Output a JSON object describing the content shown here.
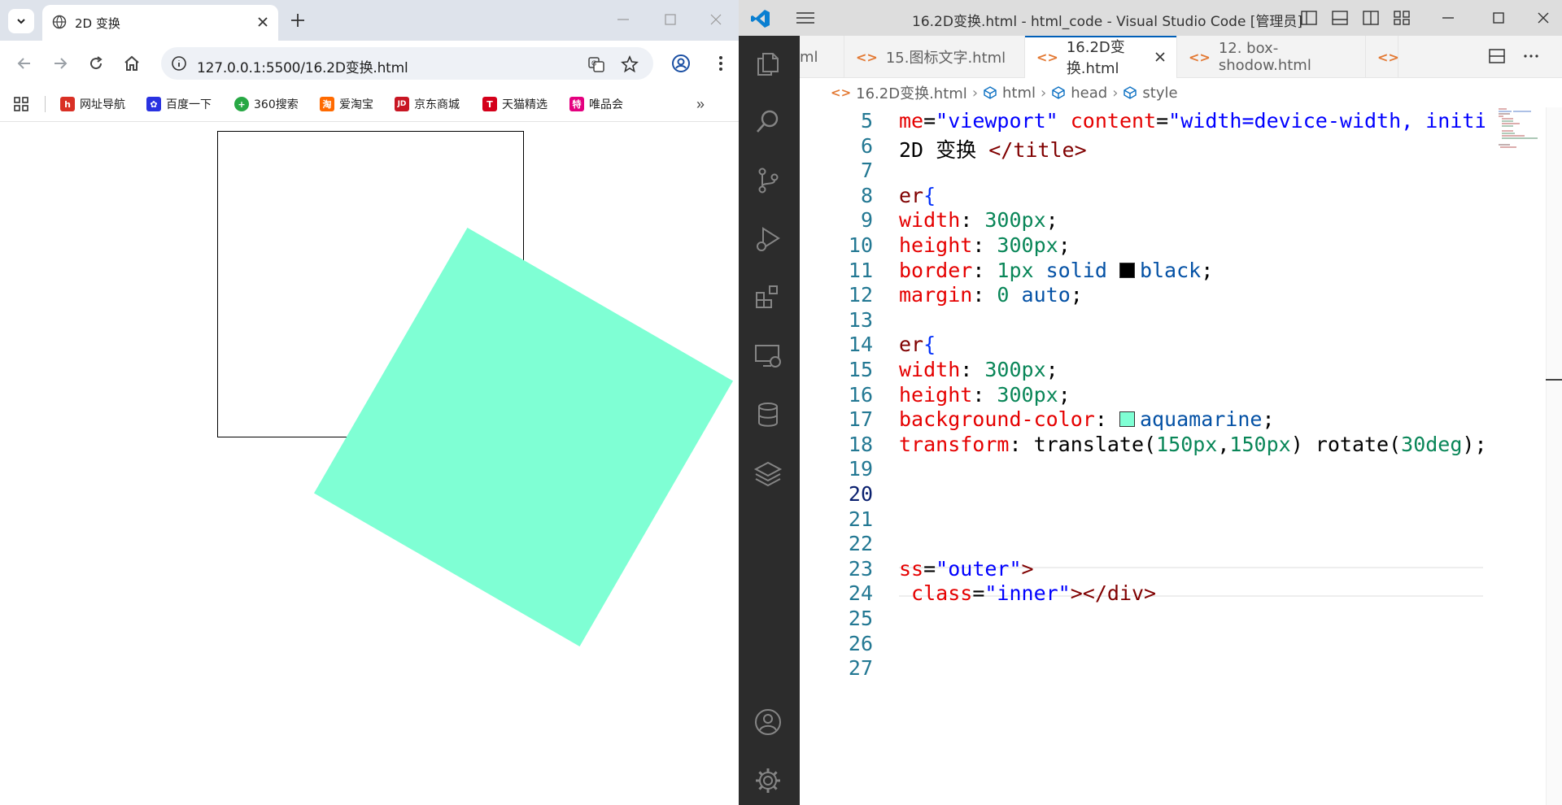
{
  "browser": {
    "tab_title": "2D 变换",
    "url": "127.0.0.1:5500/16.2D变换.html",
    "bookmarks": [
      {
        "label": "网址导航",
        "icon": "hao-icon",
        "color": "#d93025",
        "glyph": "h"
      },
      {
        "label": "百度一下",
        "icon": "baidu-icon",
        "color": "#2932e1",
        "glyph": "✿"
      },
      {
        "label": "360搜索",
        "icon": "360-icon",
        "color": "#27a844",
        "glyph": "+"
      },
      {
        "label": "爱淘宝",
        "icon": "taobao-icon",
        "color": "#ff6a00",
        "glyph": "淘"
      },
      {
        "label": "京东商城",
        "icon": "jd-icon",
        "color": "#c81623",
        "glyph": "JD"
      },
      {
        "label": "天猫精选",
        "icon": "tmall-icon",
        "color": "#d4001a",
        "glyph": "T"
      },
      {
        "label": "唯品会",
        "icon": "vip-icon",
        "color": "#e4007f",
        "glyph": "特"
      }
    ],
    "content": {
      "outer_border_color": "#000000",
      "inner_color": "#7fffd4",
      "inner_rotate_deg": 30
    }
  },
  "vscode": {
    "window_title": "16.2D变换.html - html_code - Visual Studio Code [管理员]",
    "tabs": [
      {
        "label": "ml",
        "active": false
      },
      {
        "label": "15.图标文字.html",
        "active": false
      },
      {
        "label": "16.2D变换.html",
        "active": true
      },
      {
        "label": "12. box-shodow.html",
        "active": false
      }
    ],
    "breadcrumbs": [
      "16.2D变换.html",
      "html",
      "head",
      "style"
    ],
    "current_line": 20,
    "lines": [
      {
        "n": 5
      },
      {
        "n": 6
      },
      {
        "n": 7
      },
      {
        "n": 8
      },
      {
        "n": 9
      },
      {
        "n": 10
      },
      {
        "n": 11
      },
      {
        "n": 12
      },
      {
        "n": 13
      },
      {
        "n": 14
      },
      {
        "n": 15
      },
      {
        "n": 16
      },
      {
        "n": 17
      },
      {
        "n": 18
      },
      {
        "n": 19
      },
      {
        "n": 20
      },
      {
        "n": 21
      },
      {
        "n": 22
      },
      {
        "n": 23
      },
      {
        "n": 24
      },
      {
        "n": 25
      },
      {
        "n": 26
      },
      {
        "n": 27
      }
    ],
    "code": {
      "l5_a": "me",
      "l5_b": "=",
      "l5_c": "\"viewport\"",
      "l5_d": " content",
      "l5_e": "=",
      "l5_f": "\"width=device-width, initi",
      "l6_a": "2D 变换 ",
      "l6_b": "</title>",
      "l8_a": "er",
      "l8_b": "{",
      "l9_a": "width",
      "l9_b": ": ",
      "l9_c": "300px",
      "l9_d": ";",
      "l10_a": "height",
      "l10_b": ": ",
      "l10_c": "300px",
      "l10_d": ";",
      "l11_a": "border",
      "l11_b": ": ",
      "l11_c": "1px",
      "l11_d": " solid ",
      "l11_e": "black",
      "l11_f": ";",
      "l12_a": "margin",
      "l12_b": ": ",
      "l12_c": "0",
      "l12_d": " auto",
      "l12_e": ";",
      "l14_a": "er",
      "l14_b": "{",
      "l15_a": "width",
      "l15_b": ": ",
      "l15_c": "300px",
      "l15_d": ";",
      "l16_a": "height",
      "l16_b": ": ",
      "l16_c": "300px",
      "l16_d": ";",
      "l17_a": "background-color",
      "l17_b": ": ",
      "l17_c": "aquamarine",
      "l17_d": ";",
      "l18_a": "transform",
      "l18_b": ": translate(",
      "l18_c": "150px",
      "l18_d": ",",
      "l18_e": "150px",
      "l18_f": ") rotate(",
      "l18_g": "30deg",
      "l18_h": ");",
      "l23_a": "ss",
      "l23_b": "=",
      "l23_c": "\"outer\"",
      "l23_d": ">",
      "l24_a": " class",
      "l24_b": "=",
      "l24_c": "\"inner\"",
      "l24_d": "></div>"
    },
    "swatch_black": "#000000",
    "swatch_aquamarine": "#7fffd4"
  }
}
